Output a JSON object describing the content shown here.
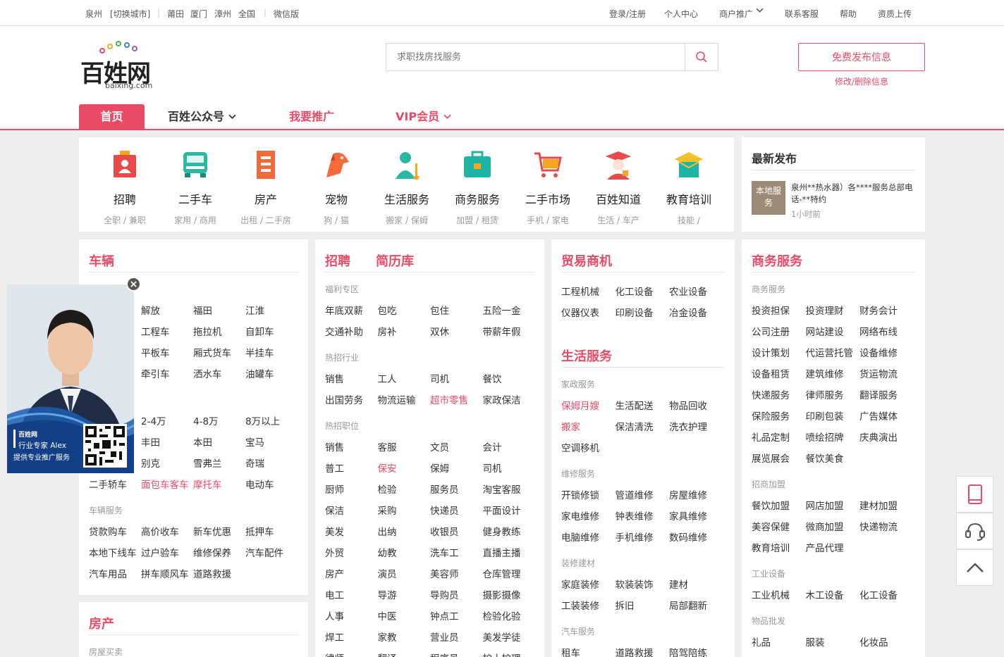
{
  "topbar": {
    "city": "泉州",
    "switch_city": "[切换城市]",
    "nearby_cities": [
      "莆田",
      "厦门",
      "漳州",
      "全国"
    ],
    "wechat": "微信版",
    "links": [
      "登录/注册",
      "个人中心",
      "商户推广",
      "联系客服",
      "帮助",
      "资质上传"
    ]
  },
  "header": {
    "logo_text": "百姓网",
    "logo_domain": "baixing.com",
    "search_placeholder": "求职找房找服务",
    "publish_button": "免费发布信息",
    "edit_link": "修改/删除信息"
  },
  "nav": {
    "home": "首页",
    "items": [
      "百姓公众号",
      "我要推广",
      "VIP会员"
    ]
  },
  "categories": [
    {
      "name": "招聘",
      "desc": "全职 / 兼职",
      "icon": "recruit-icon"
    },
    {
      "name": "二手车",
      "desc": "家用 / 商用",
      "icon": "used-car-icon"
    },
    {
      "name": "房产",
      "desc": "出租 / 二手房",
      "icon": "building-icon"
    },
    {
      "name": "宠物",
      "desc": "狗 / 猫",
      "icon": "pet-dog-icon"
    },
    {
      "name": "生活服务",
      "desc": "搬家 / 保姆",
      "icon": "housekeeper-icon"
    },
    {
      "name": "商务服务",
      "desc": "加盟 / 租赁",
      "icon": "briefcase-icon"
    },
    {
      "name": "二手市场",
      "desc": "手机 / 家电",
      "icon": "cart-icon"
    },
    {
      "name": "百姓知道",
      "desc": "生活 / 车产",
      "icon": "graduate-icon"
    },
    {
      "name": "教育培训",
      "desc": "技能 /",
      "icon": "education-icon"
    }
  ],
  "latest": {
    "title": "最新发布",
    "thumb_text": "本地服务",
    "item_text": "泉州**热水器）各****服务总部电话-**特约",
    "time": "1小时前"
  },
  "vehicles": {
    "title": "车辆",
    "brands_rows": [
      [
        "解放",
        "福田",
        "江淮"
      ],
      [
        "工程车",
        "拖拉机",
        "自卸车"
      ],
      [
        "平板车",
        "厢式货车",
        "半挂车"
      ],
      [
        "牵引车",
        "洒水车",
        "油罐车"
      ]
    ],
    "price_row": [
      "2-4万",
      "4-8万",
      "8万以上"
    ],
    "brand_row2": [
      "丰田",
      "本田",
      "宝马"
    ],
    "brand_row3": [
      "别克",
      "雪弗兰",
      "奇瑞"
    ],
    "misc_row": [
      "二手轿车",
      "面包车客车",
      "摩托车",
      "电动车"
    ],
    "service_sub": "车辆服务",
    "service_rows": [
      [
        "贷款购车",
        "高价收车",
        "新车优惠",
        "抵押车"
      ],
      [
        "本地下线车",
        "过户验车",
        "维修保养",
        "汽车配件"
      ],
      [
        "汽车用品",
        "拼车顺风车",
        "道路救援"
      ]
    ]
  },
  "house": {
    "title": "房产",
    "sub": "房屋买卖"
  },
  "recruit": {
    "title": "招聘",
    "title2": "简历库",
    "welfare_sub": "福利专区",
    "welfare_rows": [
      [
        "年底双薪",
        "包吃",
        "包住",
        "五险一金"
      ],
      [
        "交通补助",
        "房补",
        "双休",
        "带薪年假"
      ]
    ],
    "hot_industry_sub": "热招行业",
    "industry_rows": [
      [
        "销售",
        "工人",
        "司机",
        "餐饮"
      ],
      [
        "出国劳务",
        "物流运输",
        "超市零售",
        "家政保洁"
      ]
    ],
    "hot_position_sub": "热招职位",
    "position_rows": [
      [
        "销售",
        "客服",
        "文员",
        "会计"
      ],
      [
        "普工",
        "保安",
        "保姆",
        "司机"
      ],
      [
        "厨师",
        "检验",
        "服务员",
        "淘宝客服"
      ],
      [
        "保洁",
        "采购",
        "快递员",
        "平面设计"
      ],
      [
        "美发",
        "出纳",
        "收银员",
        "健身教练"
      ],
      [
        "外贸",
        "幼教",
        "洗车工",
        "直播主播"
      ],
      [
        "房产",
        "演员",
        "美容师",
        "仓库管理"
      ],
      [
        "电工",
        "导游",
        "导购员",
        "摄影摄像"
      ],
      [
        "人事",
        "中医",
        "钟点工",
        "检验化验"
      ],
      [
        "焊工",
        "家教",
        "营业员",
        "美发学徒"
      ],
      [
        "律师",
        "翻译",
        "程序员",
        "护士护理"
      ]
    ]
  },
  "trade": {
    "title": "贸易商机",
    "rows": [
      [
        "工程机械",
        "化工设备",
        "农业设备"
      ],
      [
        "仪器仪表",
        "印刷设备",
        "冶金设备"
      ]
    ]
  },
  "life": {
    "title": "生活服务",
    "home_sub": "家政服务",
    "home_rows": [
      [
        "保姆月嫂",
        "生活配送",
        "物品回收"
      ],
      [
        "搬家",
        "保洁清洗",
        "洗衣护理"
      ],
      [
        "空调移机"
      ]
    ],
    "repair_sub": "维修服务",
    "repair_rows": [
      [
        "开锁修锁",
        "管道维修",
        "房屋维修"
      ],
      [
        "家电维修",
        "钟表维修",
        "家具维修"
      ],
      [
        "电脑维修",
        "手机维修",
        "数码维修"
      ]
    ],
    "deco_sub": "装修建材",
    "deco_rows": [
      [
        "家庭装修",
        "软装装饰",
        "建材"
      ],
      [
        "工装装修",
        "拆旧",
        "局部翻新"
      ]
    ],
    "car_sub": "汽车服务",
    "car_rows": [
      [
        "租车",
        "道路救援",
        "陪驾陪练"
      ]
    ]
  },
  "business": {
    "title": "商务服务",
    "biz_sub": "商务服务",
    "biz_rows": [
      [
        "投资担保",
        "投资理财",
        "财务会计"
      ],
      [
        "公司注册",
        "网站建设",
        "网络布线"
      ],
      [
        "设计策划",
        "代运营托管",
        "设备维修"
      ],
      [
        "设备租赁",
        "建筑维修",
        "货运物流"
      ],
      [
        "快递服务",
        "律师服务",
        "翻译服务"
      ],
      [
        "保险服务",
        "印刷包装",
        "广告媒体"
      ],
      [
        "礼品定制",
        "喷绘招牌",
        "庆典演出"
      ],
      [
        "展览展会",
        "餐饮美食"
      ]
    ],
    "franchise_sub": "招商加盟",
    "franchise_rows": [
      [
        "餐饮加盟",
        "网店加盟",
        "建材加盟"
      ],
      [
        "美容保健",
        "微商加盟",
        "快递物流"
      ],
      [
        "教育培训",
        "产品代理"
      ]
    ],
    "industrial_sub": "工业设备",
    "industrial_rows": [
      [
        "工业机械",
        "木工设备",
        "化工设备"
      ]
    ],
    "wholesale_sub": "物品批发",
    "wholesale_rows": [
      [
        "礼品",
        "服装",
        "化妆品"
      ]
    ]
  },
  "popup": {
    "brand": "百姓网",
    "line1": "行业专家 Alex",
    "line2": "提供专业推广服务"
  },
  "colors": {
    "accent": "#e94b67"
  }
}
